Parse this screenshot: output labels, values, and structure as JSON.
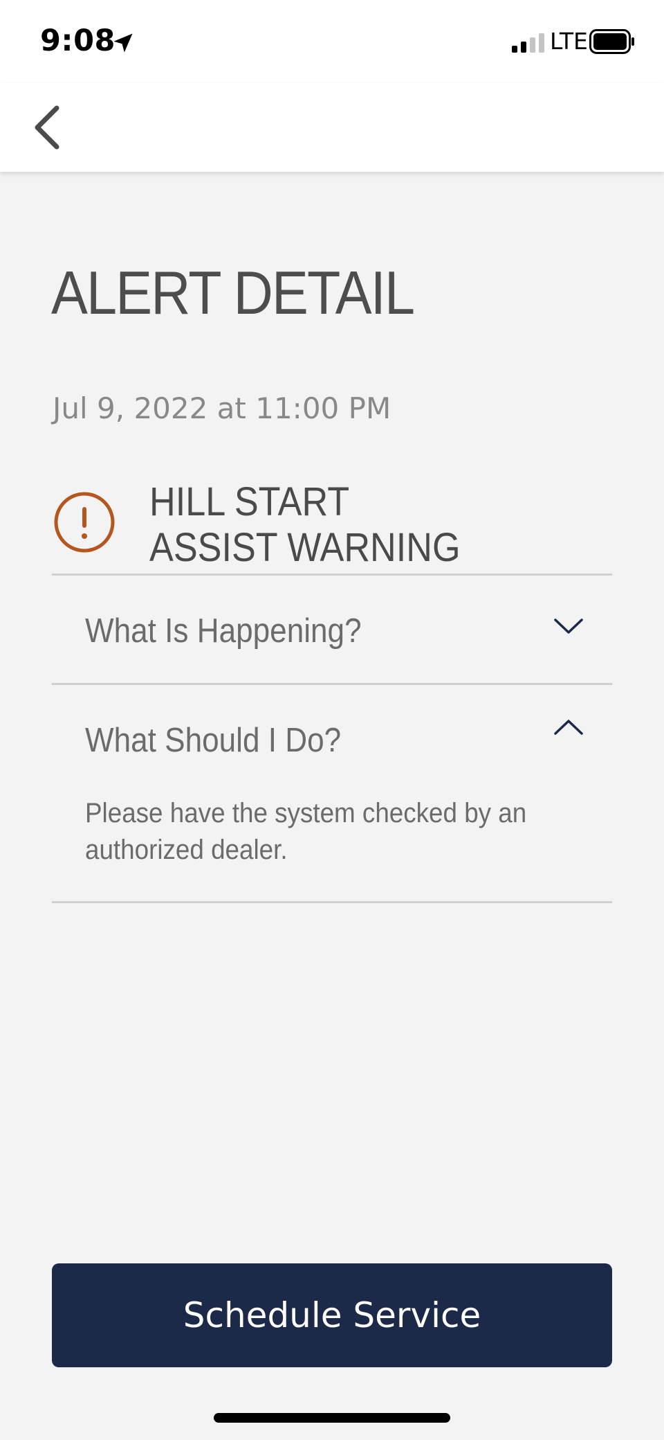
{
  "status_bar": {
    "time": "9:08",
    "network": "LTE",
    "icons": [
      "location-arrow-icon",
      "signal-icon",
      "battery-icon"
    ]
  },
  "nav": {
    "back_icon": "chevron-left-icon"
  },
  "page": {
    "title": "ALERT DETAIL",
    "date": "Jul 9, 2022 at 11:00 PM"
  },
  "alert": {
    "name": "HILL START\nASSIST WARNING",
    "icon": "warning-exclamation-icon",
    "icon_color": "#b5561f"
  },
  "accordion": [
    {
      "title": "What Is Happening?",
      "expanded": false,
      "icon": "chevron-down-icon"
    },
    {
      "title": "What Should I Do?",
      "expanded": true,
      "icon": "chevron-up-icon",
      "body": "Please have the system checked by an authorized dealer."
    }
  ],
  "actions": {
    "schedule_label": "Schedule Service",
    "button_color": "#1c2948"
  }
}
